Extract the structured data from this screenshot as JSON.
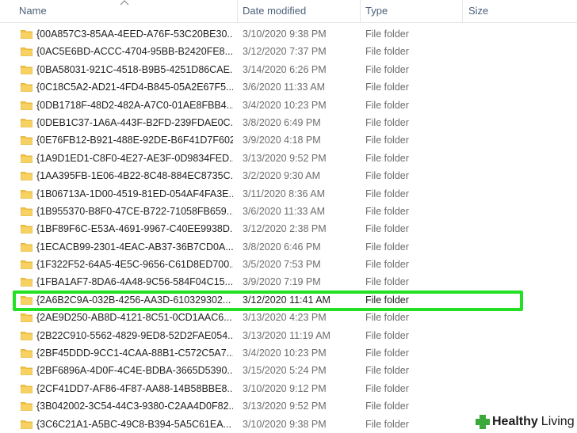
{
  "header": {
    "name": "Name",
    "date_modified": "Date modified",
    "type": "Type",
    "size": "Size",
    "sort_icon": "chevron-up-icon"
  },
  "colors": {
    "folder": "#f4c542",
    "highlight_border": "#22e022"
  },
  "rows": [
    {
      "name": "{00A857C3-85AA-4EED-A76F-53C20BE30...",
      "date": "3/10/2020 9:38 PM",
      "type": "File folder"
    },
    {
      "name": "{0AC5E6BD-ACCC-4704-95BB-B2420FE8...",
      "date": "3/12/2020 7:37 PM",
      "type": "File folder"
    },
    {
      "name": "{0BA58031-921C-4518-B9B5-4251D86CAE...",
      "date": "3/14/2020 6:26 PM",
      "type": "File folder"
    },
    {
      "name": "{0C18C5A2-AD21-4FD4-B845-05A2E67F5...",
      "date": "3/6/2020 11:33 AM",
      "type": "File folder"
    },
    {
      "name": "{0DB1718F-48D2-482A-A7C0-01AE8FBB4...",
      "date": "3/4/2020 10:23 PM",
      "type": "File folder"
    },
    {
      "name": "{0DEB1C37-1A6A-443F-B2FD-239FDAE0C...",
      "date": "3/8/2020 6:49 PM",
      "type": "File folder"
    },
    {
      "name": "{0E76FB12-B921-488E-92DE-B6F41D7F602...",
      "date": "3/9/2020 4:18 PM",
      "type": "File folder"
    },
    {
      "name": "{1A9D1ED1-C8F0-4E27-AE3F-0D9834FED...",
      "date": "3/13/2020 9:52 PM",
      "type": "File folder"
    },
    {
      "name": "{1AA395FB-1E06-4B22-8C48-884EC8735C...",
      "date": "3/2/2020 9:30 AM",
      "type": "File folder"
    },
    {
      "name": "{1B06713A-1D00-4519-81ED-054AF4FA3E...",
      "date": "3/11/2020 8:36 AM",
      "type": "File folder"
    },
    {
      "name": "{1B955370-B8F0-47CE-B722-71058FB659...",
      "date": "3/6/2020 11:33 AM",
      "type": "File folder"
    },
    {
      "name": "{1BF89F6C-E53A-4691-9967-C40EE9938D...",
      "date": "3/12/2020 2:38 PM",
      "type": "File folder"
    },
    {
      "name": "{1ECACB99-2301-4EAC-AB37-36B7CD0A...",
      "date": "3/8/2020 6:46 PM",
      "type": "File folder"
    },
    {
      "name": "{1F322F52-64A5-4E5C-9656-C61D8ED700...",
      "date": "3/5/2020 7:53 PM",
      "type": "File folder"
    },
    {
      "name": "{1FBA1AF7-8DA6-4A48-9C56-584F04C15...",
      "date": "3/9/2020 7:19 PM",
      "type": "File folder"
    },
    {
      "name": "{2A6B2C9A-032B-4256-AA3D-610329302...",
      "date": "3/12/2020 11:41 AM",
      "type": "File folder",
      "highlighted": true
    },
    {
      "name": "{2AE9D250-AB8D-4121-8C51-0CD1AAC6...",
      "date": "3/13/2020 4:23 PM",
      "type": "File folder"
    },
    {
      "name": "{2B22C910-5562-4829-9ED8-52D2FAE054...",
      "date": "3/13/2020 11:19 AM",
      "type": "File folder"
    },
    {
      "name": "{2BF45DDD-9CC1-4CAA-88B1-C572C5A7...",
      "date": "3/4/2020 10:23 PM",
      "type": "File folder"
    },
    {
      "name": "{2BF6896A-4D0F-4C4E-BDBA-3665D5390...",
      "date": "3/15/2020 5:24 PM",
      "type": "File folder"
    },
    {
      "name": "{2CF41DD7-AF86-4F87-AA88-14B58BBE8...",
      "date": "3/10/2020 9:12 PM",
      "type": "File folder"
    },
    {
      "name": "{3B042002-3C54-44C3-9380-C2AA4D0F82...",
      "date": "3/13/2020 9:52 PM",
      "type": "File folder"
    },
    {
      "name": "{3C6C21A1-A5BC-49C8-B394-5A5C61EA...",
      "date": "3/10/2020 9:38 PM",
      "type": "File folder"
    }
  ],
  "watermark": {
    "brand_bold": "Healthy",
    "brand_light": "Living",
    "icon": "leaf-icon"
  }
}
